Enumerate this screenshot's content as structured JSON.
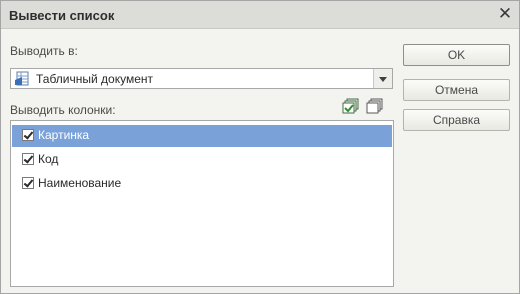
{
  "dialog": {
    "title": "Вывести список",
    "close_label": "✕"
  },
  "output_to": {
    "label": "Выводить в:",
    "selected": "Табличный документ",
    "icon": "spreadsheet-document-icon"
  },
  "columns": {
    "label": "Выводить колонки:",
    "tools": [
      "check-all-icon",
      "uncheck-all-icon"
    ],
    "items": [
      {
        "label": "Картинка",
        "checked": true,
        "selected": true
      },
      {
        "label": "Код",
        "checked": true,
        "selected": false
      },
      {
        "label": "Наименование",
        "checked": true,
        "selected": false
      }
    ]
  },
  "buttons": {
    "ok": "OK",
    "cancel": "Отмена",
    "help": "Справка"
  },
  "colors": {
    "selection": "#7aa2d8",
    "title_bar": "#dcdcd8",
    "dialog_bg": "#f3f3ef"
  }
}
